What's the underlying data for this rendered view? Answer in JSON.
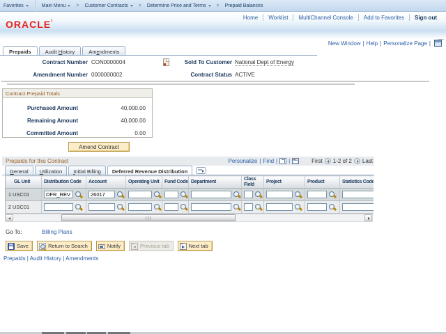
{
  "crumb_bar": {
    "favorites": "Favorites",
    "crumbs": [
      "Main Menu",
      "Customer Contracts",
      "Determine Price and Terms",
      "Prepaid Balances"
    ]
  },
  "portal_header": {
    "links": [
      "Home",
      "Worklist",
      "MultiChannel Console",
      "Add to Favorites"
    ],
    "sign_out": "Sign out",
    "logo": "ORACLE"
  },
  "page_links": {
    "new_window": "New Window",
    "help": "Help",
    "personalize": "Personalize Page"
  },
  "page_tabs": [
    {
      "label": "Prepaids",
      "key": "",
      "active": true
    },
    {
      "label": "Audit History",
      "key": "H",
      "active": false
    },
    {
      "label": "Amendments",
      "key": "e",
      "active": false
    }
  ],
  "fields": {
    "contract_number_label": "Contract Number",
    "contract_number": "CON0000004",
    "amendment_number_label": "Amendment Number",
    "amendment_number": "0000000002",
    "sold_to_label": "Sold To Customer",
    "sold_to": "National Dept of Energy",
    "status_label": "Contract Status",
    "status": "ACTIVE"
  },
  "totals": {
    "title": "Contract Prepaid Totals",
    "rows": [
      {
        "label": "Purchased Amount",
        "value": "40,000.00"
      },
      {
        "label": "Remaining Amount",
        "value": "40,000.00"
      },
      {
        "label": "Committed Amount",
        "value": "0.00"
      }
    ]
  },
  "amend_button": "Amend Contract",
  "grid": {
    "title": "Prepaids for this Contract",
    "personalize": "Personalize",
    "find": "Find",
    "pager": {
      "first": "First",
      "range": "1-2 of 2",
      "last": "Last"
    },
    "tabs": [
      {
        "label": "General",
        "key": "G",
        "active": false
      },
      {
        "label": "Utilization",
        "key": "U",
        "active": false
      },
      {
        "label": "Initial Billing",
        "key": "I",
        "active": false
      },
      {
        "label": "Deferred Revenue Distribution",
        "key": "",
        "active": true
      }
    ],
    "columns": [
      "GL Unit",
      "Distribution Code",
      "Account",
      "Operating Unit",
      "Fund Code",
      "Department",
      "Class Field",
      "Project",
      "Product",
      "Statistics Code"
    ],
    "rows": [
      {
        "num": "1",
        "gl_unit": "USC01",
        "distribution_code": "DFR_REV",
        "account": "26017",
        "operating_unit": "",
        "fund_code": "",
        "department": "",
        "class_field": "",
        "project": "",
        "product": "",
        "statistics_code": ""
      },
      {
        "num": "2",
        "gl_unit": "USC01",
        "distribution_code": "",
        "account": "",
        "operating_unit": "",
        "fund_code": "",
        "department": "",
        "class_field": "",
        "project": "",
        "product": "",
        "statistics_code": ""
      }
    ]
  },
  "goto": {
    "label": "Go To:",
    "link": "Billing Plans"
  },
  "toolbar": {
    "save": "Save",
    "return_to_search": "Return to Search",
    "notify": "Notify",
    "previous_tab": "Previous tab",
    "next_tab": "Next tab"
  },
  "footer_links": [
    "Prepaids",
    "Audit History",
    "Amendments"
  ]
}
